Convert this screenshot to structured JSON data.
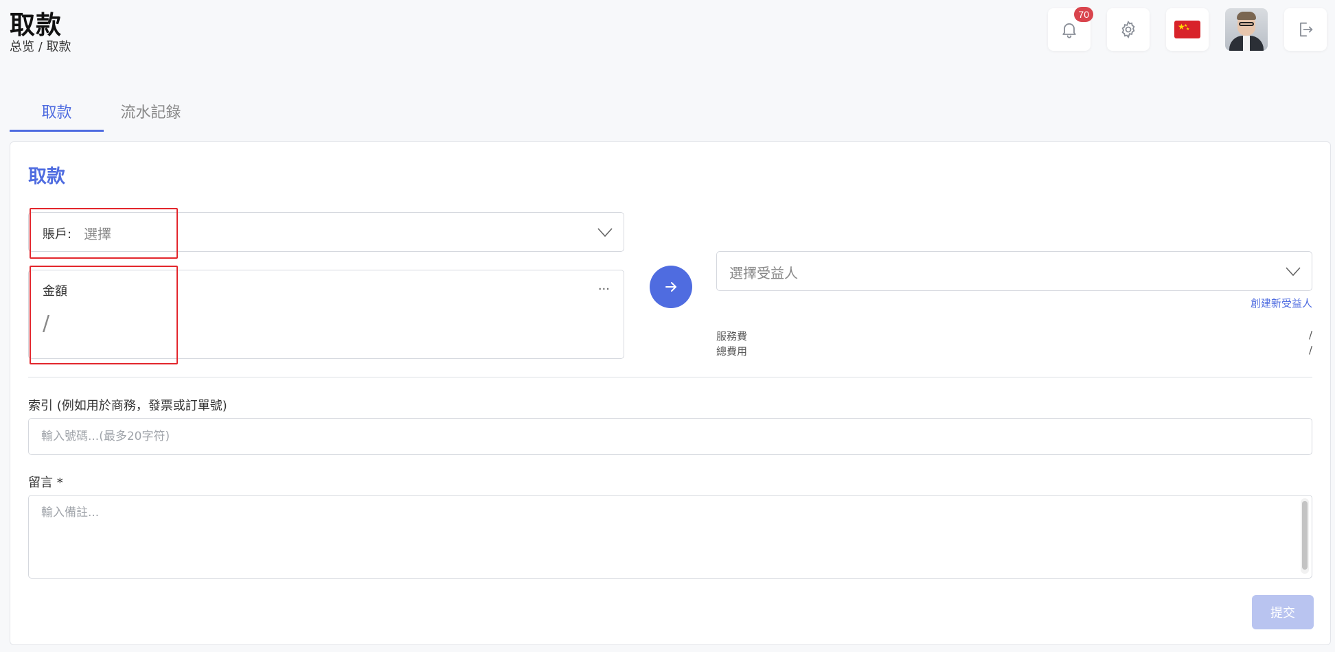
{
  "header": {
    "title": "取款",
    "breadcrumb": "总览 / 取款",
    "notifications_count": "70",
    "icons": [
      "bell-icon",
      "gear-icon",
      "china-flag-icon",
      "avatar",
      "logout-icon"
    ]
  },
  "tabs": [
    {
      "label": "取款",
      "active": true
    },
    {
      "label": "流水記錄",
      "active": false
    }
  ],
  "form": {
    "title": "取款",
    "account": {
      "label": "賬戶:",
      "value": "選擇"
    },
    "amount": {
      "label": "金額",
      "value": "/",
      "more": "..."
    },
    "beneficiary": {
      "placeholder": "選擇受益人",
      "create_link": "創建新受益人"
    },
    "fees": [
      {
        "label": "服務費",
        "value": "/"
      },
      {
        "label": "總費用",
        "value": "/"
      }
    ],
    "index": {
      "label": "索引 (例如用於商務，發票或訂單號)",
      "placeholder": "輸入號碼...(最多20字符)"
    },
    "note": {
      "label": "留言 *",
      "placeholder": "輸入備註..."
    },
    "submit_label": "提交"
  },
  "colors": {
    "accent": "#4f6ce0",
    "badge": "#d9444d",
    "highlight_box": "#e3262c",
    "submit_disabled": "#b9c4f0"
  }
}
